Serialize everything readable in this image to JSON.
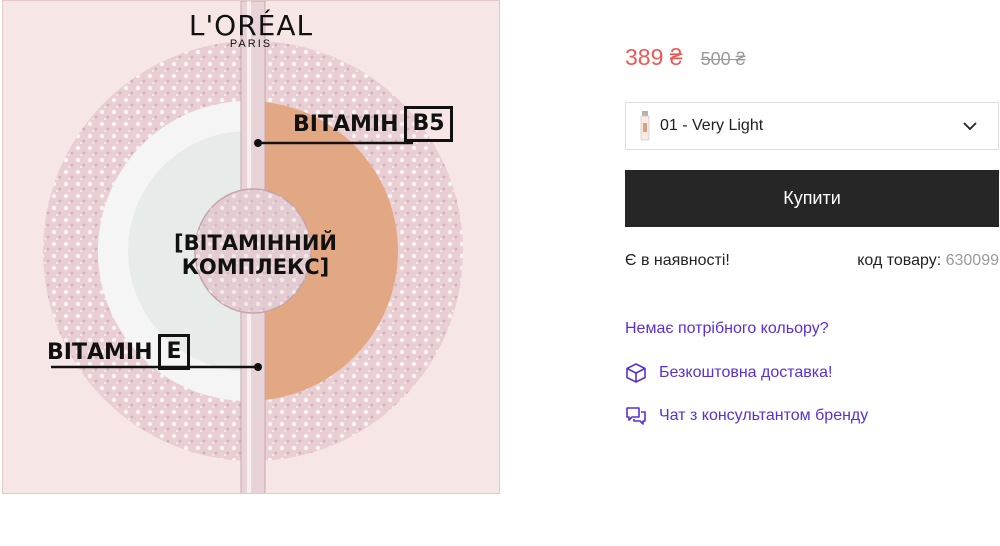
{
  "brand": {
    "name": "L'ORÉAL",
    "sub": "PARIS"
  },
  "image_labels": {
    "vitamin_b5_word": "ВІТАМІН",
    "vitamin_b5_code": "B5",
    "complex_line1": "[ВІТАМІННИЙ",
    "complex_line2": "КОМПЛЕКС]",
    "vitamin_e_word": "ВІТАМІН",
    "vitamin_e_code": "E"
  },
  "price": {
    "current": "389 ₴",
    "old": "500 ₴"
  },
  "shade_select": {
    "value": "01 - Very Light"
  },
  "buy_button": {
    "label": "Купити"
  },
  "stock": {
    "status": "Є в наявності!",
    "sku_label": "код товару:",
    "sku_value": "630099"
  },
  "links": {
    "no_color": "Немає потрібного кольору?",
    "delivery": "Безкоштовна доставка!",
    "chat": "Чат з консультантом бренду"
  },
  "colors": {
    "price": "#ea5a55",
    "link": "#5a2fd8",
    "button": "#262626",
    "foundation": "#e2a883"
  },
  "icons": {
    "delivery": "box-icon",
    "chat": "chat-icon",
    "select": "chevron-down-icon"
  }
}
